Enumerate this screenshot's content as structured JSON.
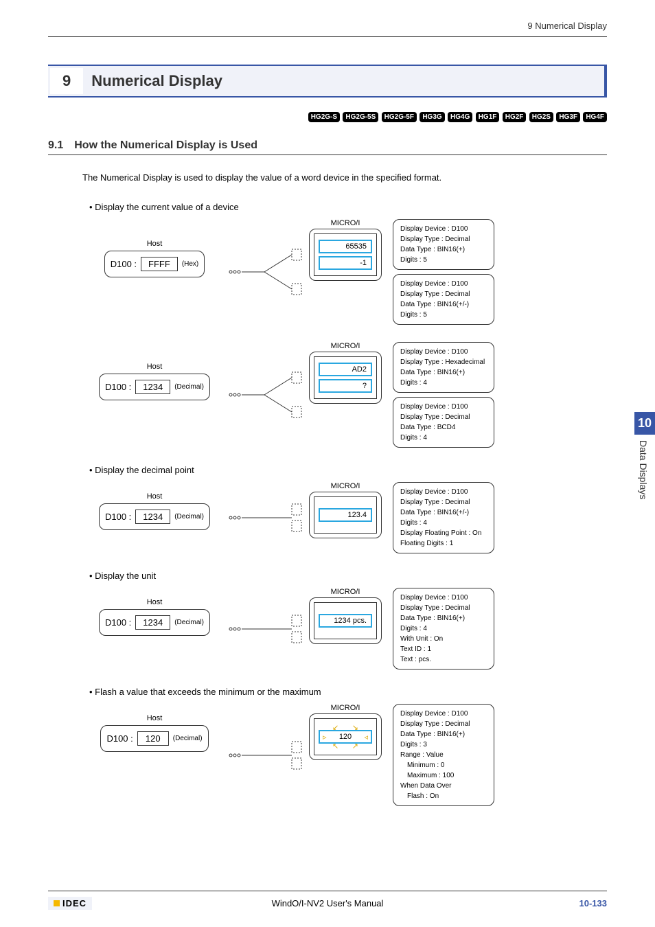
{
  "header": {
    "right": "9 Numerical Display"
  },
  "chapter": {
    "num": "9",
    "title": "Numerical Display"
  },
  "badges": [
    "HG2G-S",
    "HG2G-5S",
    "HG2G-5F",
    "HG3G",
    "HG4G",
    "HG1F",
    "HG2F",
    "HG2S",
    "HG3F",
    "HG4F"
  ],
  "section": {
    "num": "9.1",
    "title": "How the Numerical Display is Used"
  },
  "intro": "The Numerical Display is used to display the value of a word device in the specified format.",
  "bullets": {
    "b1": "Display the current value of a device",
    "b2": "Display the decimal point",
    "b3": "Display the unit",
    "b4": "Flash a value that exceeds the minimum or the maximum"
  },
  "labels": {
    "host": "Host",
    "micro": "MICRO/I",
    "device": "D100 :",
    "hex": "(Hex)",
    "decimal": "(Decimal)"
  },
  "d1": {
    "host_value": "FFFF",
    "v1": "65535",
    "v2": "-1",
    "cfg1": {
      "l1": "Display Device : D100",
      "l2": "Display Type : Decimal",
      "l3": "Data Type : BIN16(+)",
      "l4": "Digits : 5"
    },
    "cfg2": {
      "l1": "Display Device : D100",
      "l2": "Display Type : Decimal",
      "l3": "Data Type : BIN16(+/-)",
      "l4": "Digits : 5"
    }
  },
  "d2": {
    "host_value": "1234",
    "v1": "AD2",
    "v2": "?",
    "cfg1": {
      "l1": "Display Device : D100",
      "l2": "Display Type : Hexadecimal",
      "l3": "Data Type : BIN16(+)",
      "l4": "Digits : 4"
    },
    "cfg2": {
      "l1": "Display Device : D100",
      "l2": "Display Type : Decimal",
      "l3": "Data Type : BCD4",
      "l4": "Digits : 4"
    }
  },
  "d3": {
    "host_value": "1234",
    "v1": "123.4",
    "cfg1": {
      "l1": "Display Device : D100",
      "l2": "Display Type : Decimal",
      "l3": "Data Type : BIN16(+/-)",
      "l4": "Digits : 4",
      "l5": "Display Floating Point : On",
      "l6": "Floating Digits : 1"
    }
  },
  "d4": {
    "host_value": "1234",
    "v1": "1234 pcs.",
    "cfg1": {
      "l1": "Display Device : D100",
      "l2": "Display Type : Decimal",
      "l3": "Data Type : BIN16(+)",
      "l4": "Digits : 4",
      "l5": "With Unit : On",
      "l6": "Text ID : 1",
      "l7": "Text : pcs."
    }
  },
  "d5": {
    "host_value": "120",
    "v1": "120",
    "cfg1": {
      "l1": "Display Device : D100",
      "l2": "Display Type : Decimal",
      "l3": "Data Type : BIN16(+)",
      "l4": "Digits : 3",
      "l5": "Range : Value",
      "l6": "Minimum : 0",
      "l7": "Maximum : 100",
      "l8": "When Data Over",
      "l9": "Flash : On"
    }
  },
  "sidetab": {
    "num": "10",
    "text": "Data Displays"
  },
  "footer": {
    "logo": "IDEC",
    "center": "WindO/I-NV2 User's Manual",
    "page": "10-133"
  }
}
